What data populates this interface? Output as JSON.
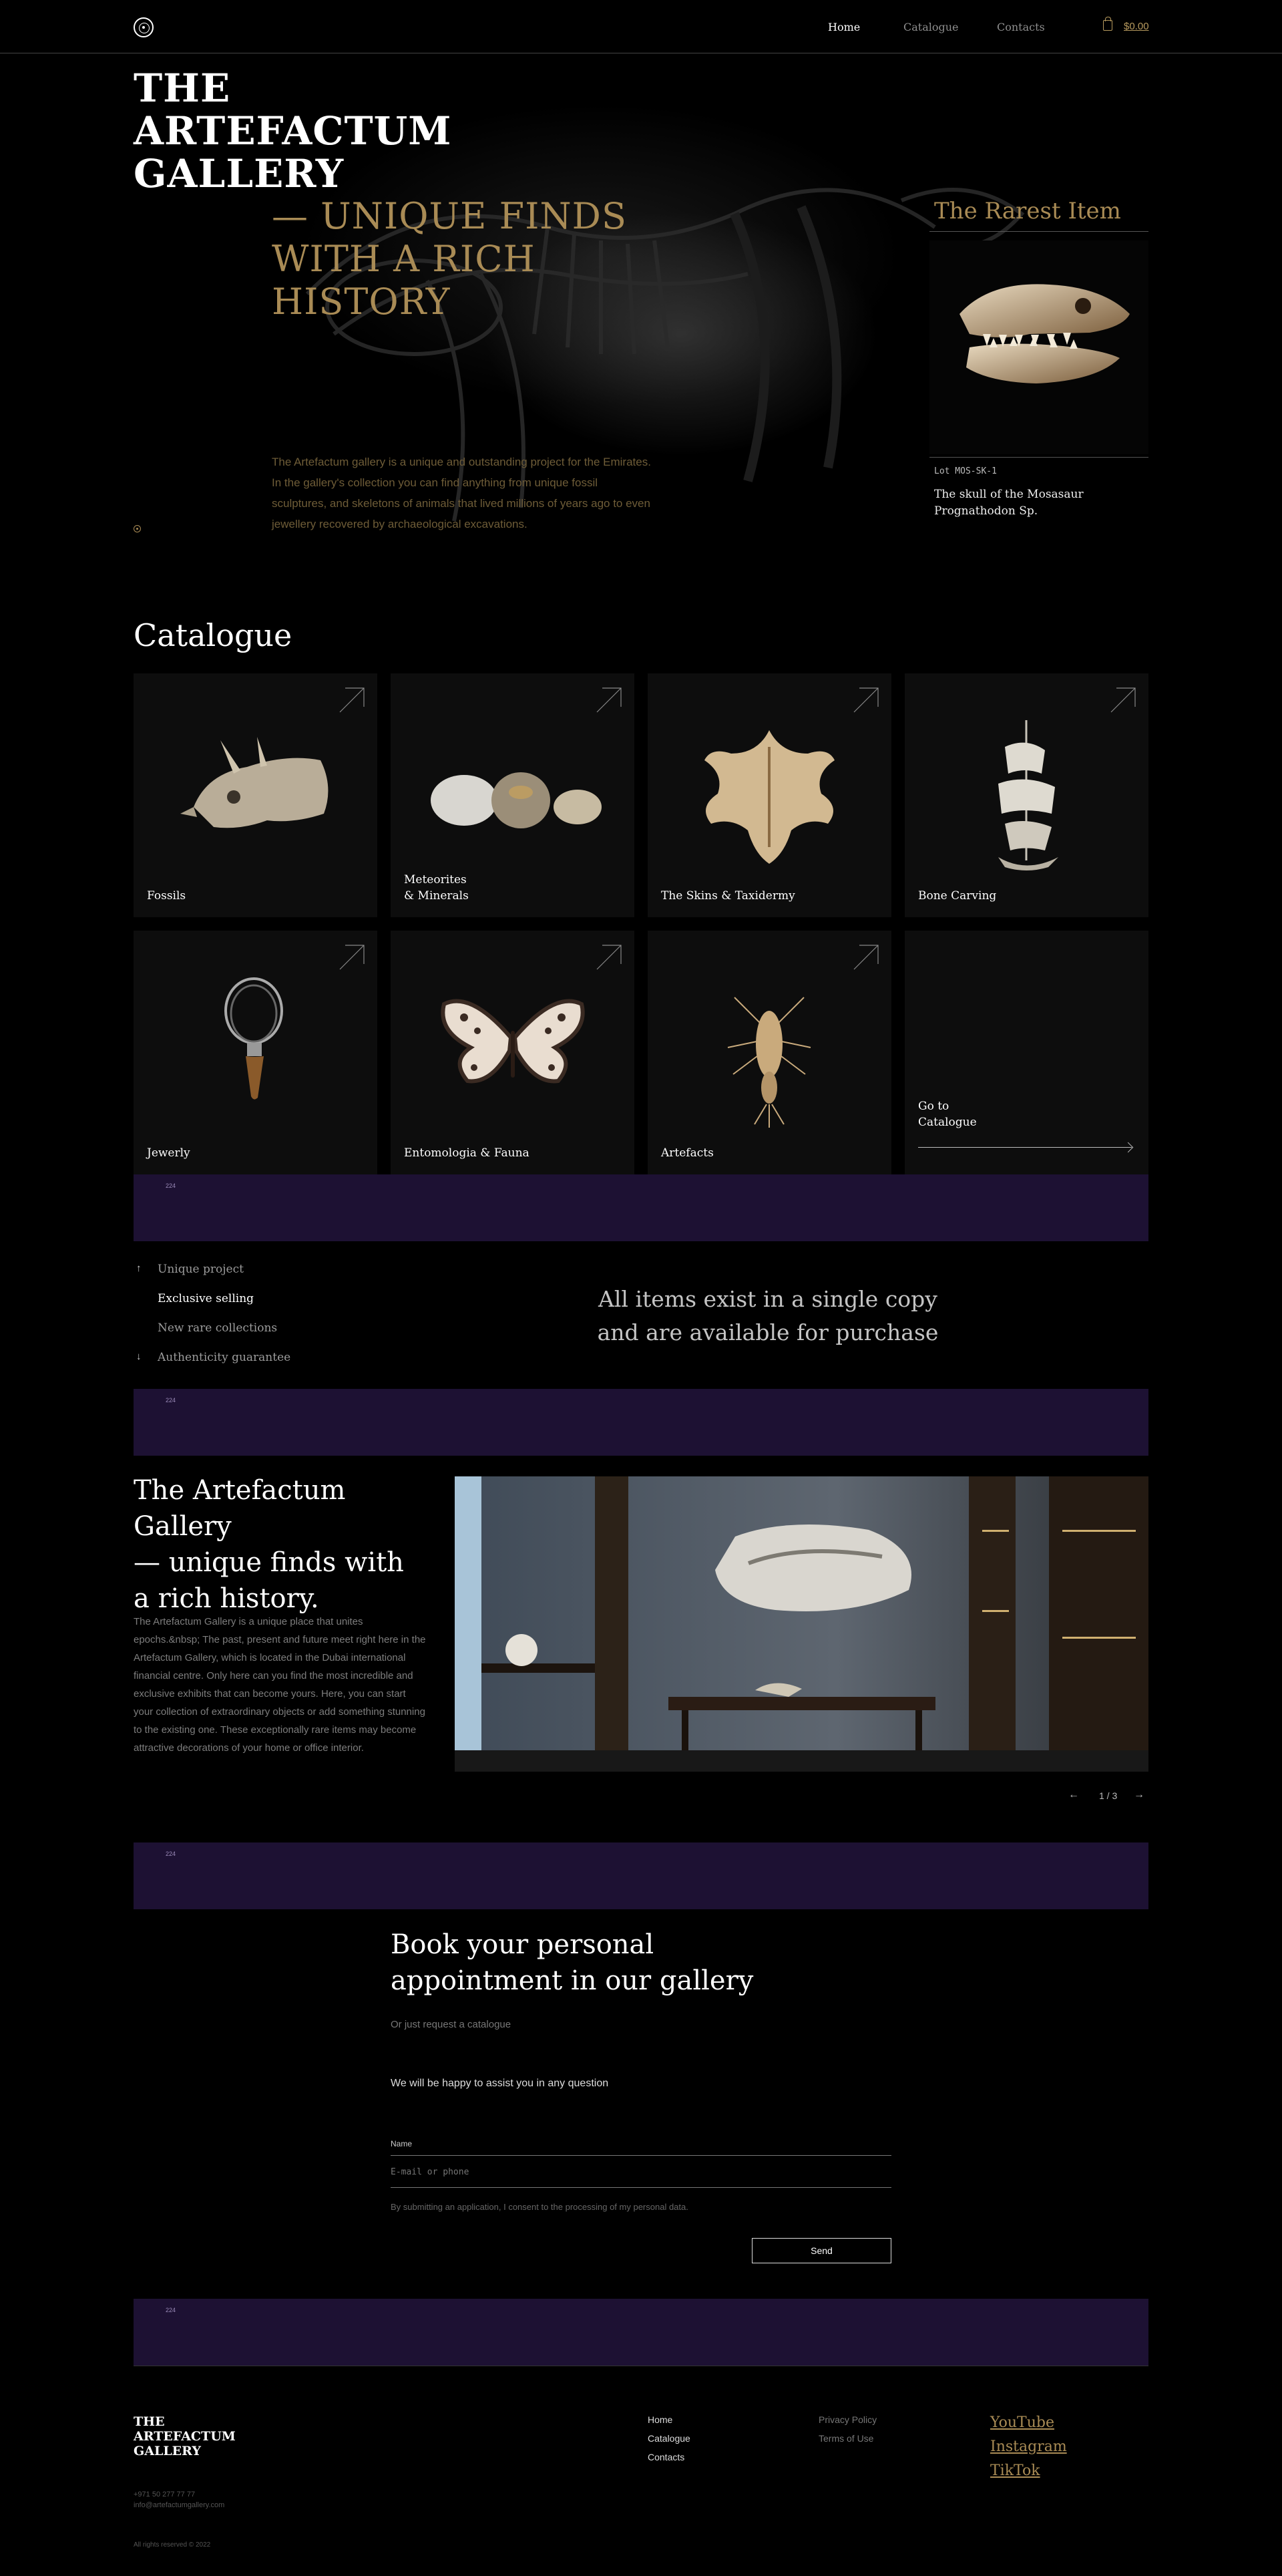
{
  "header": {
    "nav": [
      "Home",
      "Catalogue",
      "Contacts"
    ],
    "cart_total": "$0.00"
  },
  "hero": {
    "title_lines": [
      "THE",
      "ARTEFACTUM",
      "GALLERY"
    ],
    "subtitle_lines": [
      "— UNIQUE FINDS",
      "WITH A RICH",
      "HISTORY"
    ],
    "description": "The Artefactum gallery is a unique and outstanding project for the Emirates. In the gallery's collection you can find anything from unique fossil sculptures, and skeletons of animals that lived millions of years ago to even jewellery recovered by archaeological excavations.",
    "rarest": {
      "heading": "The Rarest Item",
      "lot": "Lot MOS-SK-1",
      "name": "The skull of the Mosasaur Prognathodon Sp."
    }
  },
  "catalogue": {
    "title": "Catalogue",
    "items": [
      "Fossils",
      "Meteorites\n& Minerals",
      "The Skins & Taxidermy",
      "Bone Carving",
      "Jewerly",
      "Entomologia & Fauna",
      "Artefacts"
    ],
    "goto": "Go to\nCatalogue"
  },
  "banner_tag": "224",
  "features": {
    "items": [
      "Unique project",
      "Exclusive selling",
      "New rare collections",
      "Authenticity guarantee"
    ],
    "headline": "All items exist in a single copy\nand are available for purchase"
  },
  "about": {
    "title": "The Artefactum Gallery\n— unique finds with\na rich history.",
    "body": "The Artefactum Gallery is a unique place that unites epochs.&nbsp; The past, present and future meet right here in the Artefactum Gallery, which is located in the Dubai international financial centre.  Only here can you find the most incredible and exclusive exhibits that can become yours. Here, you can start your collection of extraordinary objects or add something stunning to the existing one. These exceptionally rare items may become attractive decorations of your home or office interior.",
    "slider": "1 / 3"
  },
  "booking": {
    "title": "Book your personal\nappointment in our gallery",
    "subtitle": "Or just request a catalogue",
    "note": "We will be happy to assist you in any question",
    "name_label": "Name",
    "contact_placeholder": "E-mail or phone",
    "consent": "By submitting an application, I consent to the processing of my personal data.",
    "send": "Send"
  },
  "footer": {
    "logo_lines": [
      "THE",
      "ARTEFACTUM",
      "GALLERY"
    ],
    "nav": [
      "Home",
      "Catalogue",
      "Contacts"
    ],
    "legal": [
      "Privacy Policy",
      "Terms of Use"
    ],
    "social": [
      "YouTube",
      "Instagram",
      "TikTok"
    ],
    "phone": "+971 50 277 77 77",
    "email": "info@artefactumgallery.com",
    "copyright": "All rights reserved © 2022"
  },
  "colors": {
    "gold": "#a98b55",
    "banner_purple": "#1d1133",
    "card_bg": "#0d0d0d"
  }
}
